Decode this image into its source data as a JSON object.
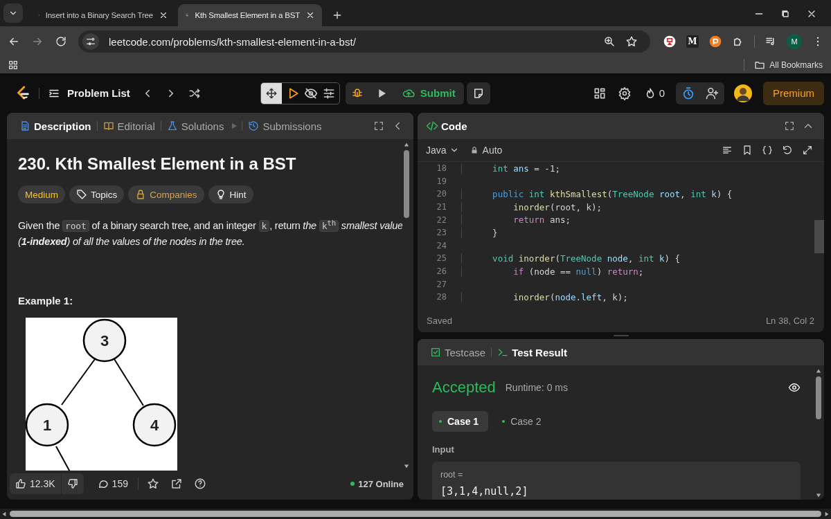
{
  "browser": {
    "tabs": [
      {
        "title": "Insert into a Binary Search Tree",
        "selected": false
      },
      {
        "title": "Kth Smallest Element in a BST",
        "selected": true
      }
    ],
    "url": "leetcode.com/problems/kth-smallest-element-in-a-bst/",
    "extension_letter": "M",
    "profile_initial": "M",
    "bookmarks": "All Bookmarks"
  },
  "navbar": {
    "problem_list": "Problem List",
    "submit": "Submit",
    "streak": "0",
    "premium": "Premium"
  },
  "left_panel": {
    "tabs": [
      {
        "label": "Description",
        "kind": "description",
        "selected": true
      },
      {
        "label": "Editorial",
        "kind": "editorial",
        "selected": false
      },
      {
        "label": "Solutions",
        "kind": "solutions",
        "selected": false
      },
      {
        "label": "Submissions",
        "kind": "submissions",
        "selected": false
      }
    ],
    "title": "230. Kth Smallest Element in a BST",
    "tags": [
      {
        "label": "Medium",
        "kind": "difficulty"
      },
      {
        "label": "Topics",
        "kind": "topics"
      },
      {
        "label": "Companies",
        "kind": "companies"
      },
      {
        "label": "Hint",
        "kind": "hint"
      }
    ],
    "statement": [
      {
        "kind": "text",
        "text": "Given the "
      },
      {
        "kind": "code",
        "text": "root"
      },
      {
        "kind": "text",
        "text": " of a binary search tree, and an integer "
      },
      {
        "kind": "code",
        "text": "k"
      },
      {
        "kind": "text",
        "text": ", return "
      },
      {
        "kind": "italic",
        "text": "the "
      },
      {
        "kind": "code",
        "text": "k$^{th}$"
      },
      {
        "kind": "italic",
        "text": " smallest value (**1-indexed**) of all the values of the nodes in the tree."
      }
    ],
    "example_heading": "Example 1:",
    "example_tree": {
      "nodes": [
        "3",
        "1",
        "4"
      ]
    },
    "footer": {
      "likes": "12.3K",
      "comments": "159",
      "online": "127 Online"
    }
  },
  "code_panel": {
    "title": "Code",
    "language": "Java",
    "mode": "Auto",
    "lines": [
      {
        "number": "18",
        "tokens": [
          {
            "text": "    int",
            "kind": "type"
          },
          {
            "text": " ans",
            "kind": "var"
          },
          {
            "text": " = -1;",
            "kind": "plain"
          }
        ]
      },
      {
        "number": "19"
      },
      {
        "number": "20",
        "tokens": [
          {
            "text": "    public",
            "kind": "keyword"
          },
          {
            "text": " int",
            "kind": "type"
          },
          {
            "text": " kthSmallest",
            "kind": "fn"
          },
          {
            "text": "(",
            "kind": "plain"
          },
          {
            "text": "TreeNode",
            "kind": "type"
          },
          {
            "text": " root",
            "kind": "var"
          },
          {
            "text": ",",
            "kind": "plain"
          },
          {
            "text": " int",
            "kind": "type"
          },
          {
            "text": " k",
            "kind": "var"
          },
          {
            "text": ") {",
            "kind": "plain"
          }
        ]
      },
      {
        "number": "21",
        "tokens": [
          {
            "text": "        inorder",
            "kind": "fn"
          },
          {
            "text": "(root, k);",
            "kind": "plain"
          }
        ]
      },
      {
        "number": "22",
        "tokens": [
          {
            "text": "        return",
            "kind": "control"
          },
          {
            "text": " ans;",
            "kind": "plain"
          }
        ]
      },
      {
        "number": "23",
        "tokens": [
          {
            "text": "    }",
            "kind": "plain"
          }
        ]
      },
      {
        "number": "24"
      },
      {
        "number": "25",
        "tokens": [
          {
            "text": "    void",
            "kind": "type"
          },
          {
            "text": " inorder",
            "kind": "fn"
          },
          {
            "text": "(",
            "kind": "plain"
          },
          {
            "text": "TreeNode",
            "kind": "type"
          },
          {
            "text": " node",
            "kind": "var"
          },
          {
            "text": ",",
            "kind": "plain"
          },
          {
            "text": " int",
            "kind": "type"
          },
          {
            "text": " k",
            "kind": "var"
          },
          {
            "text": ") {",
            "kind": "plain"
          }
        ]
      },
      {
        "number": "26",
        "tokens": [
          {
            "text": "        if",
            "kind": "control"
          },
          {
            "text": " (node == ",
            "kind": "plain"
          },
          {
            "text": "null",
            "kind": "keyword"
          },
          {
            "text": ")",
            "kind": "plain"
          },
          {
            "text": " return",
            "kind": "control"
          },
          {
            "text": ";",
            "kind": "plain"
          }
        ]
      },
      {
        "number": "27"
      },
      {
        "number": "28",
        "tokens": [
          {
            "text": "        inorder",
            "kind": "fn"
          },
          {
            "text": "(",
            "kind": "plain"
          },
          {
            "text": "node.left",
            "kind": "var"
          },
          {
            "text": ", k);",
            "kind": "plain"
          }
        ]
      }
    ],
    "status": "Saved",
    "cursor": "Ln 38, Col 2"
  },
  "result_panel": {
    "tabs": [
      {
        "label": "Testcase",
        "kind": "testcase",
        "selected": false
      },
      {
        "label": "Test Result",
        "kind": "result",
        "selected": true
      }
    ],
    "verdict": "Accepted",
    "runtime": "Runtime: 0 ms",
    "cases": [
      {
        "label": "Case 1",
        "selected": true
      },
      {
        "label": "Case 2",
        "selected": false
      }
    ],
    "input_label": "Input",
    "param": "root =",
    "value": "[3,1,4,null,2]"
  }
}
